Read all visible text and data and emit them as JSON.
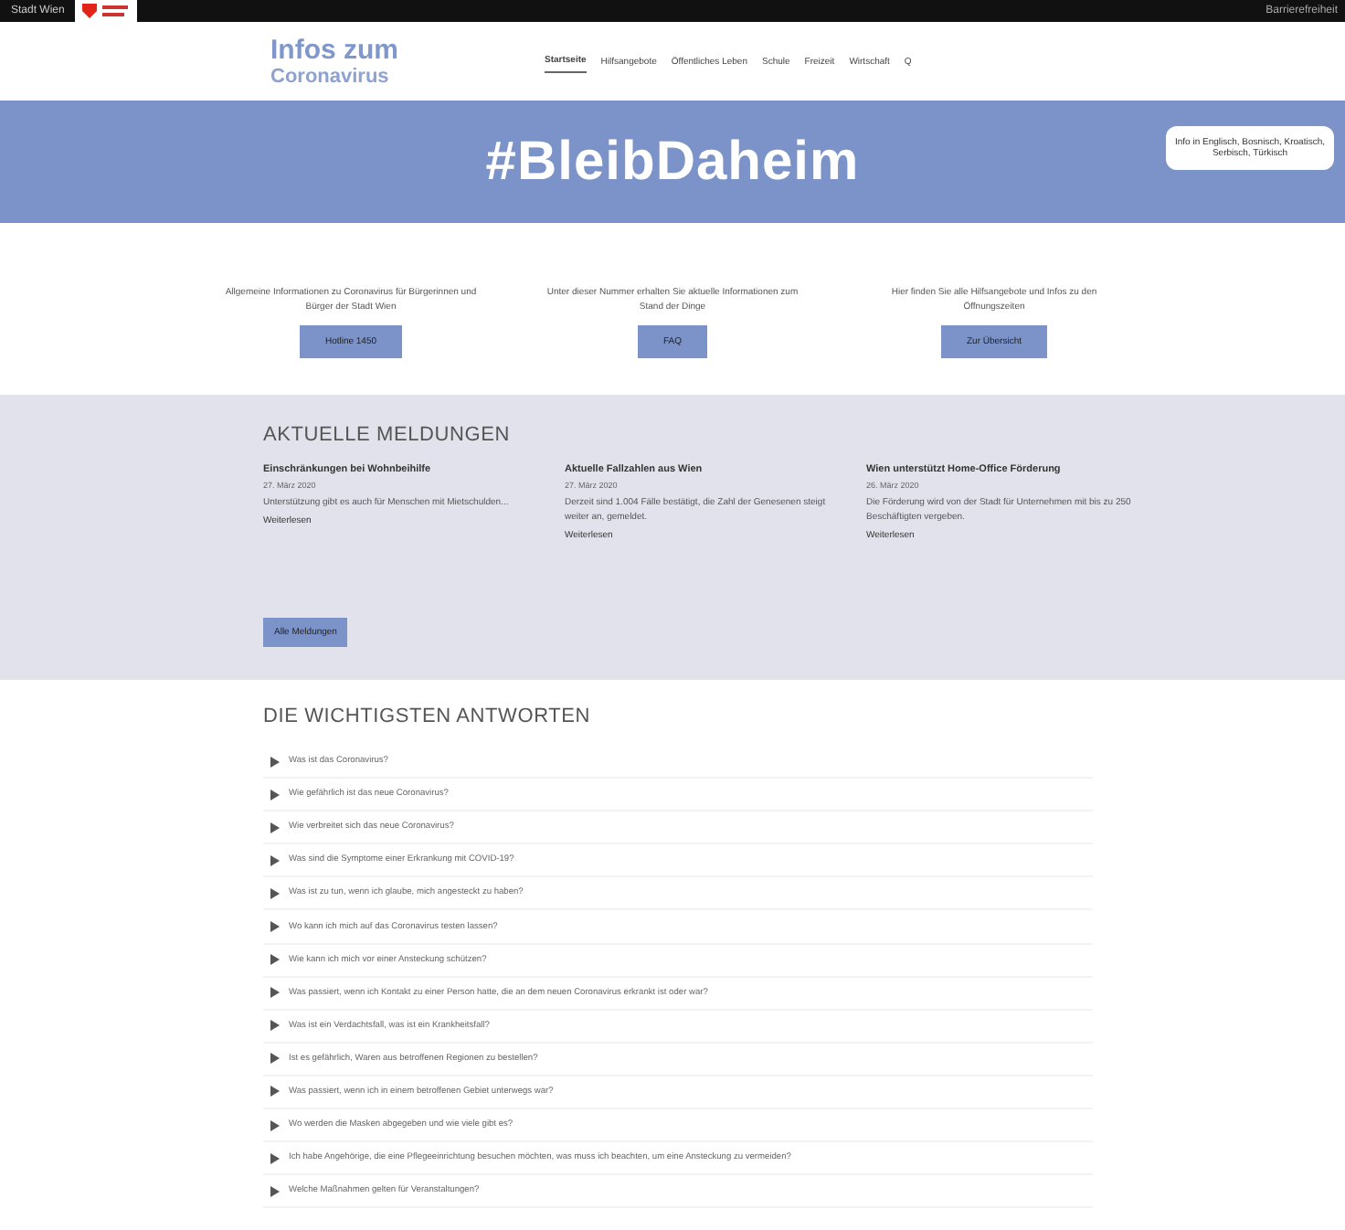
{
  "topbar": {
    "left": "Stadt Wien",
    "right": "Barrierefreiheit"
  },
  "logo": {
    "line1": "Infos zum",
    "line2": "Coronavirus"
  },
  "nav": [
    {
      "label": "Startseite",
      "selected": true
    },
    {
      "label": "Hilfsangebote",
      "selected": false
    },
    {
      "label": "Öffentliches Leben",
      "selected": false
    },
    {
      "label": "Schule",
      "selected": false
    },
    {
      "label": "Freizeit",
      "selected": false
    },
    {
      "label": "Wirtschaft",
      "selected": false
    },
    {
      "label": "Q",
      "selected": false
    }
  ],
  "banner": {
    "title": "#BleibDaheim",
    "notice": "Info in Englisch, Bosnisch, Kroatisch, Serbisch, Türkisch"
  },
  "info_blocks": [
    {
      "text": "Allgemeine Informationen zu Coronavirus für Bürgerinnen und Bürger der Stadt Wien",
      "button": "Hotline 1450"
    },
    {
      "text": "Unter dieser Nummer erhalten Sie aktuelle Informationen zum Stand der Dinge",
      "button": "FAQ"
    },
    {
      "text": "Hier finden Sie alle Hilfsangebote und Infos zu den Öffnungszeiten",
      "button": "Zur Übersicht"
    }
  ],
  "news": {
    "title": "AKTUELLE MELDUNGEN",
    "items": [
      {
        "headline": "Einschränkungen bei Wohnbeihilfe",
        "date": "27. März 2020",
        "text": "Unterstützung gibt es auch für Menschen mit Mietschulden...",
        "link": "Weiterlesen"
      },
      {
        "headline": "Aktuelle Fallzahlen aus Wien",
        "date": "27. März 2020",
        "text": "Derzeit sind 1.004 Fälle bestätigt, die Zahl der Genesenen steigt weiter an, gemeldet.",
        "link": "Weiterlesen"
      },
      {
        "headline": "Wien unterstützt Home-Office Förderung",
        "date": "26. März 2020",
        "text": "Die Förderung wird von der Stadt für Unternehmen mit bis zu 250 Beschäftigten vergeben.",
        "link": "Weiterlesen"
      }
    ],
    "button": "Alle Meldungen"
  },
  "faq": {
    "title": "DIE WICHTIGSTEN ANTWORTEN",
    "items": [
      "Was ist das Coronavirus?",
      "Wie gefährlich ist das neue Coronavirus?",
      "Wie verbreitet sich das neue Coronavirus?",
      "Was sind die Symptome einer Erkrankung mit COVID-19?",
      "Was ist zu tun, wenn ich glaube, mich angesteckt zu haben?",
      "Wo kann ich mich auf das Coronavirus testen lassen?",
      "Wie kann ich mich vor einer Ansteckung schützen?",
      "Was passiert, wenn ich Kontakt zu einer Person hatte, die an dem neuen Coronavirus erkrankt ist oder war?",
      "Was ist ein Verdachtsfall, was ist ein Krankheitsfall?",
      "Ist es gefährlich, Waren aus betroffenen Regionen zu bestellen?",
      "Was passiert, wenn ich in einem betroffenen Gebiet unterwegs war?",
      "Wo werden die Masken abgegeben und wie viele gibt es?",
      "Ich habe Angehörige, die eine Pflegeeinrichtung besuchen möchten, was muss ich beachten, um eine Ansteckung zu vermeiden?",
      "Welche Maßnahmen gelten für Veranstaltungen?"
    ]
  }
}
